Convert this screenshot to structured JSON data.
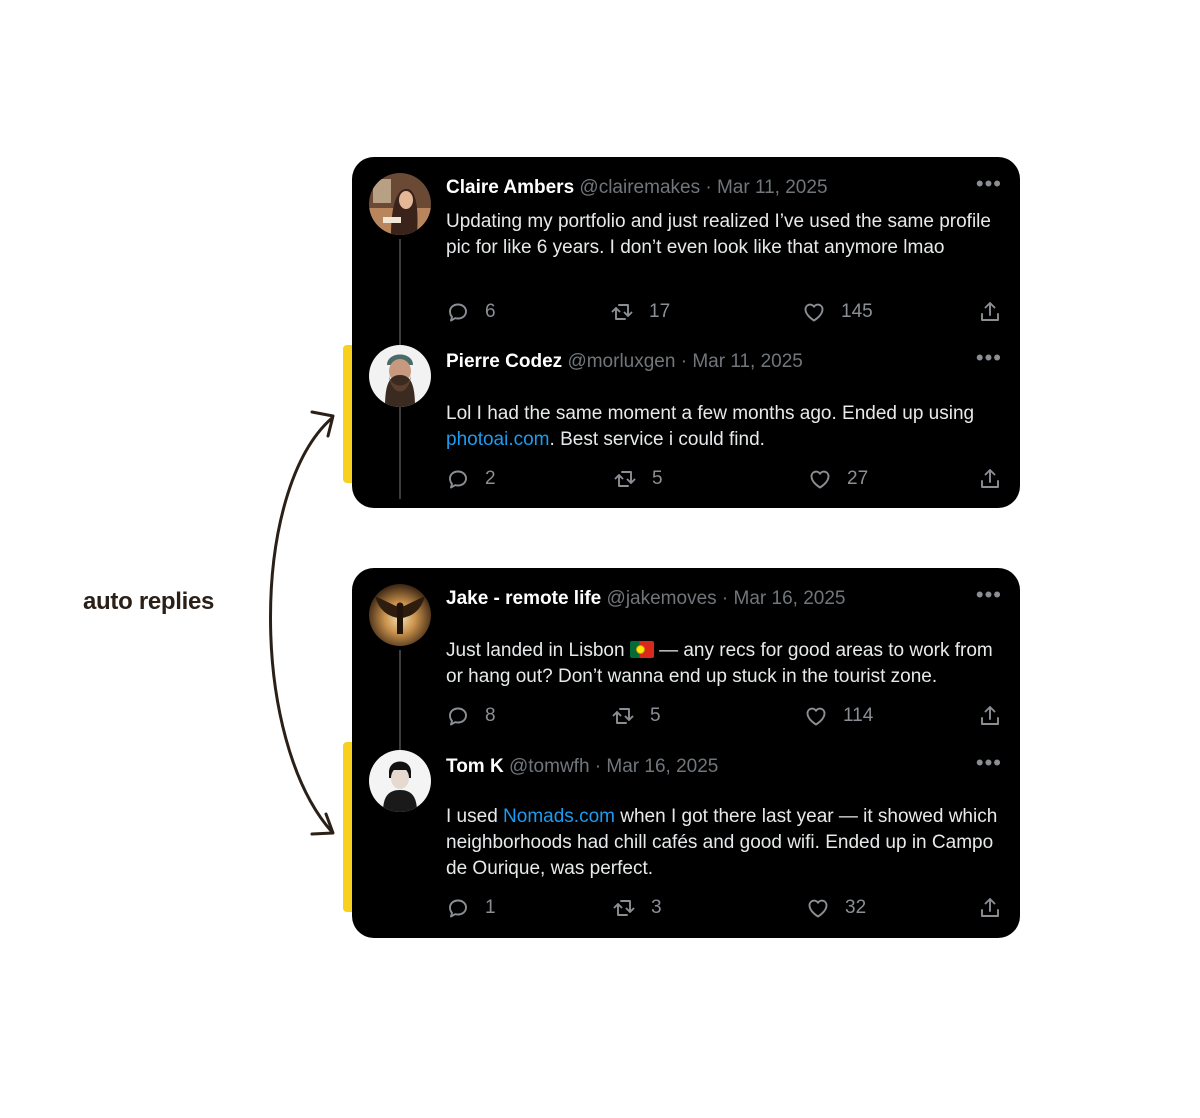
{
  "annotation": {
    "label": "auto replies"
  },
  "threads": [
    {
      "original": {
        "name": "Claire Ambers",
        "meta": "@clairemakes · Mar 11, 2025",
        "text": "Updating my portfolio and just realized I’ve used the same profile pic for like 6 years. I don’t even look like that anymore lmao",
        "replies": "6",
        "retweets": "17",
        "likes": "145"
      },
      "reply": {
        "name": "Pierre Codez",
        "meta": "@morluxgen · Mar 11, 2025",
        "text_before": "Lol I had the same moment a few months ago. Ended up using ",
        "link": "photoai.com",
        "text_after": ". Best service i could find.",
        "replies": "2",
        "retweets": "5",
        "likes": "27"
      }
    },
    {
      "original": {
        "name": "Jake - remote life",
        "meta": "@jakemoves · Mar 16, 2025",
        "text_before": "Just landed in Lisbon ",
        "flag_icon": "portugal-flag-icon",
        "text_after": " — any recs for good areas to work from or hang out? Don’t wanna end up stuck in the tourist zone.",
        "replies": "8",
        "retweets": "5",
        "likes": "114"
      },
      "reply": {
        "name": "Tom K",
        "meta": "@tomwfh · Mar 16, 2025",
        "text_before": "I used ",
        "link": "Nomads.com",
        "text_after": " when I got there last year — it showed which neighborhoods had chill cafés and good wifi. Ended up in Campo de Ourique, was perfect.",
        "replies": "1",
        "retweets": "3",
        "likes": "32"
      }
    }
  ],
  "colors": {
    "accent_bar": "#f7d11e",
    "card_bg": "#000000",
    "link": "#1d9bf0",
    "muted": "#71767b"
  }
}
